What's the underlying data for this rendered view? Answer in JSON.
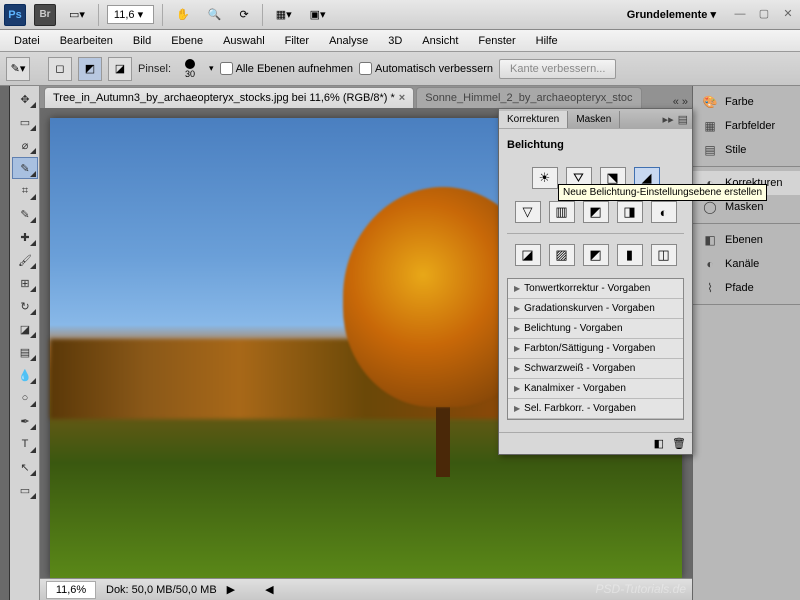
{
  "topbar": {
    "zoom": "11,6",
    "workspace": "Grundelemente"
  },
  "menu": {
    "items": [
      "Datei",
      "Bearbeiten",
      "Bild",
      "Ebene",
      "Auswahl",
      "Filter",
      "Analyse",
      "3D",
      "Ansicht",
      "Fenster",
      "Hilfe"
    ]
  },
  "options": {
    "brush_label": "Pinsel:",
    "brush_size": "30",
    "chk_all_layers": "Alle Ebenen aufnehmen",
    "chk_auto": "Automatisch verbessern",
    "refine_btn": "Kante verbessern..."
  },
  "tabs": {
    "tab1": "Tree_in_Autumn3_by_archaeopteryx_stocks.jpg bei 11,6% (RGB/8*) *",
    "tab2": "Sonne_Himmel_2_by_archaeopteryx_stoc"
  },
  "status": {
    "zoom": "11,6%",
    "doc": "Dok: 50,0 MB/50,0 MB"
  },
  "korr_panel": {
    "tab1": "Korrekturen",
    "tab2": "Masken",
    "title": "Belichtung",
    "presets": [
      "Tonwertkorrektur - Vorgaben",
      "Gradationskurven - Vorgaben",
      "Belichtung - Vorgaben",
      "Farbton/Sättigung - Vorgaben",
      "Schwarzweiß - Vorgaben",
      "Kanalmixer - Vorgaben",
      "Sel. Farbkorr. - Vorgaben"
    ]
  },
  "tooltip": "Neue Belichtung-Einstellungsebene erstellen",
  "right": {
    "farbe": "Farbe",
    "farbfelder": "Farbfelder",
    "stile": "Stile",
    "korrekturen": "Korrekturen",
    "masken": "Masken",
    "ebenen": "Ebenen",
    "kanale": "Kanäle",
    "pfade": "Pfade"
  },
  "watermark": "PSD-Tutorials.de"
}
